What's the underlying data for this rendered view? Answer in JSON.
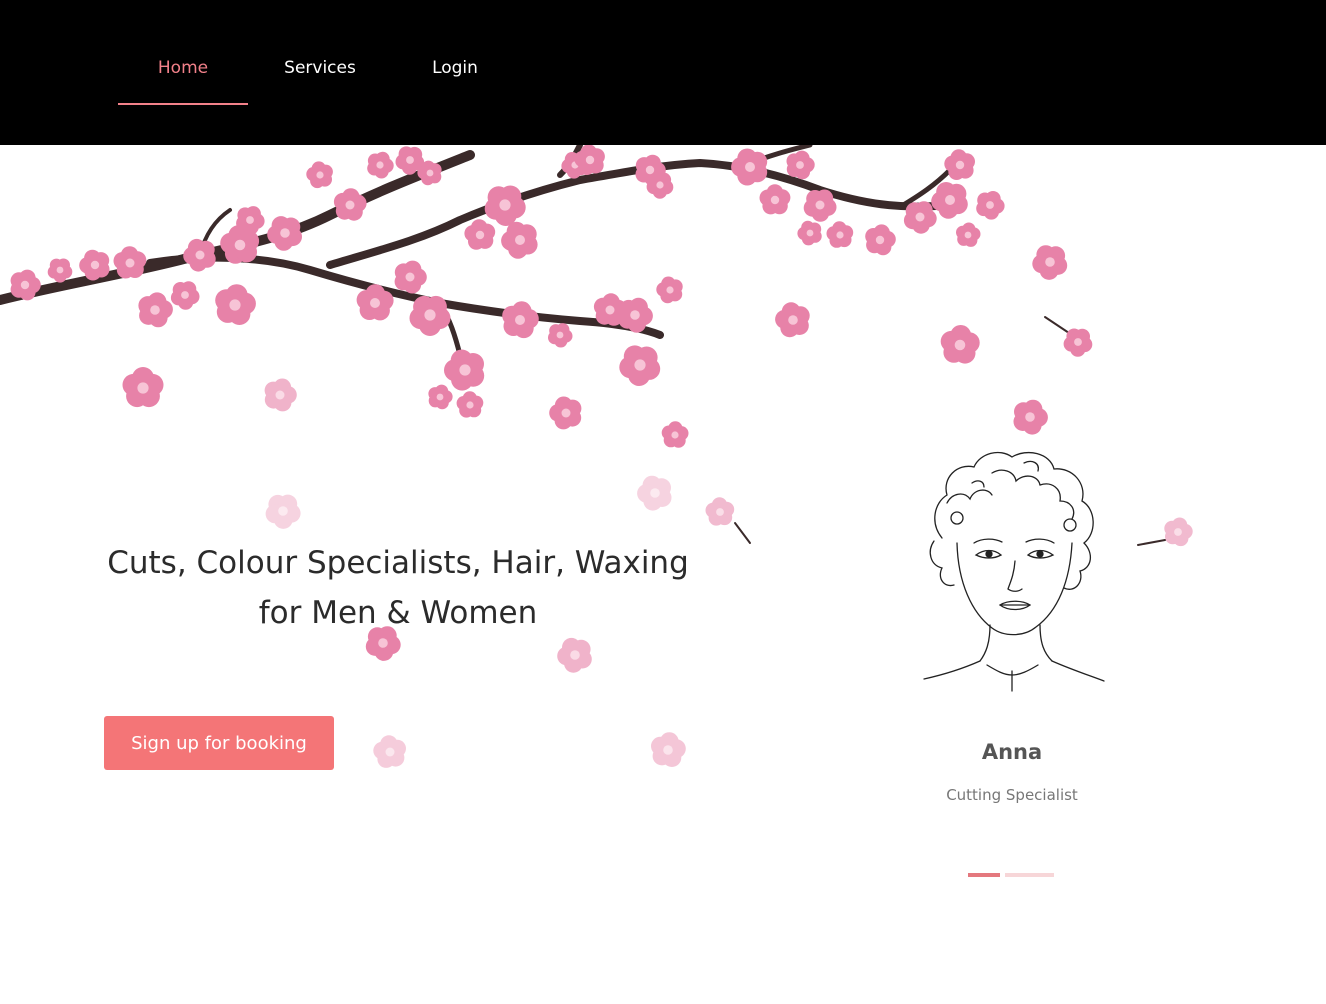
{
  "nav": {
    "items": [
      {
        "label": "Home",
        "active": true
      },
      {
        "label": "Services",
        "active": false
      },
      {
        "label": "Login",
        "active": false
      }
    ]
  },
  "hero": {
    "title_line1": "Cuts, Colour Specialists, Hair, Waxing",
    "title_line2": "for Men & Women",
    "cta_label": "Sign up for booking"
  },
  "stylist": {
    "name": "Anna",
    "role": "Cutting Specialist",
    "portrait_icon": "woman-sketch-portrait-icon"
  },
  "carousel": {
    "slide_count": 3,
    "active_index": 0
  },
  "colors": {
    "nav_background": "#000000",
    "accent": "#f2818a",
    "button": "#f47577",
    "blossom": "#e782a8",
    "branch": "#3a2a2a",
    "text": "#2b2b2b"
  },
  "decor": {
    "background_icon": "cherry-blossom-branch-icon"
  }
}
